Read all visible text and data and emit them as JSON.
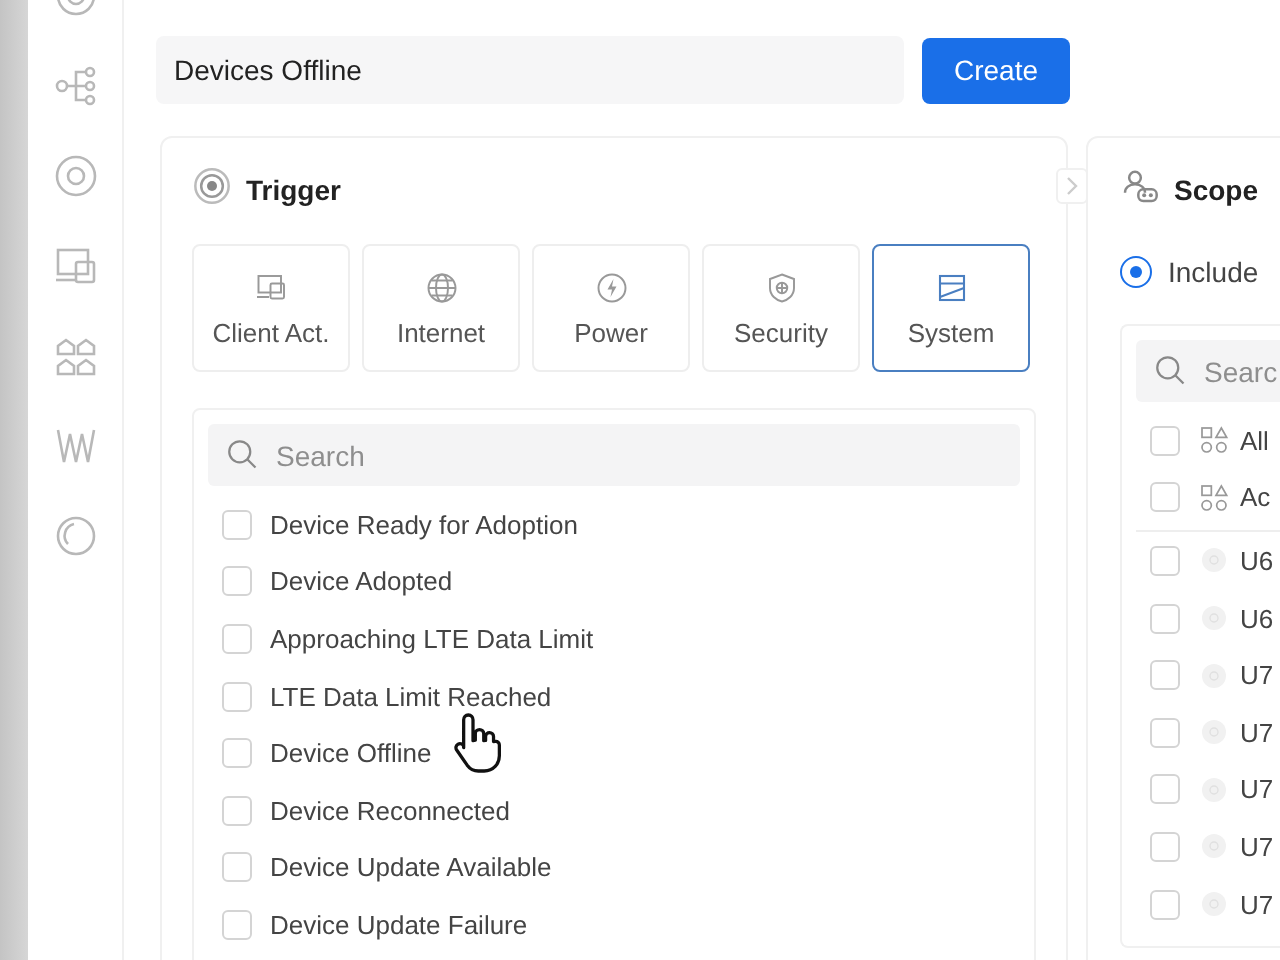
{
  "name_field": {
    "value": "Devices Offline"
  },
  "create_button": {
    "label": "Create"
  },
  "trigger": {
    "title": "Trigger",
    "categories": [
      {
        "label": "Client Act.",
        "selected": false
      },
      {
        "label": "Internet",
        "selected": false
      },
      {
        "label": "Power",
        "selected": false
      },
      {
        "label": "Security",
        "selected": false
      },
      {
        "label": "System",
        "selected": true
      }
    ],
    "search": {
      "placeholder": "Search"
    },
    "events": [
      {
        "label": "Device Ready for Adoption",
        "checked": false
      },
      {
        "label": "Device Adopted",
        "checked": false
      },
      {
        "label": "Approaching LTE Data Limit",
        "checked": false
      },
      {
        "label": "LTE Data Limit Reached",
        "checked": false
      },
      {
        "label": "Device Offline",
        "checked": false
      },
      {
        "label": "Device Reconnected",
        "checked": false
      },
      {
        "label": "Device Update Available",
        "checked": false
      },
      {
        "label": "Device Update Failure",
        "checked": false
      }
    ]
  },
  "scope": {
    "title": "Scope",
    "mode": {
      "label": "Include",
      "selected": true
    },
    "search": {
      "placeholder": "Searc"
    },
    "targets": [
      {
        "kind": "group",
        "label": "All",
        "checked": false
      },
      {
        "kind": "group",
        "label": "Ac",
        "checked": false
      },
      {
        "kind": "device",
        "label": "U6",
        "checked": false
      },
      {
        "kind": "device",
        "label": "U6",
        "checked": false
      },
      {
        "kind": "device",
        "label": "U7",
        "checked": false
      },
      {
        "kind": "device",
        "label": "U7",
        "checked": false
      },
      {
        "kind": "device",
        "label": "U7",
        "checked": false
      },
      {
        "kind": "device",
        "label": "U7",
        "checked": false
      },
      {
        "kind": "device",
        "label": "U7",
        "checked": false
      }
    ]
  }
}
